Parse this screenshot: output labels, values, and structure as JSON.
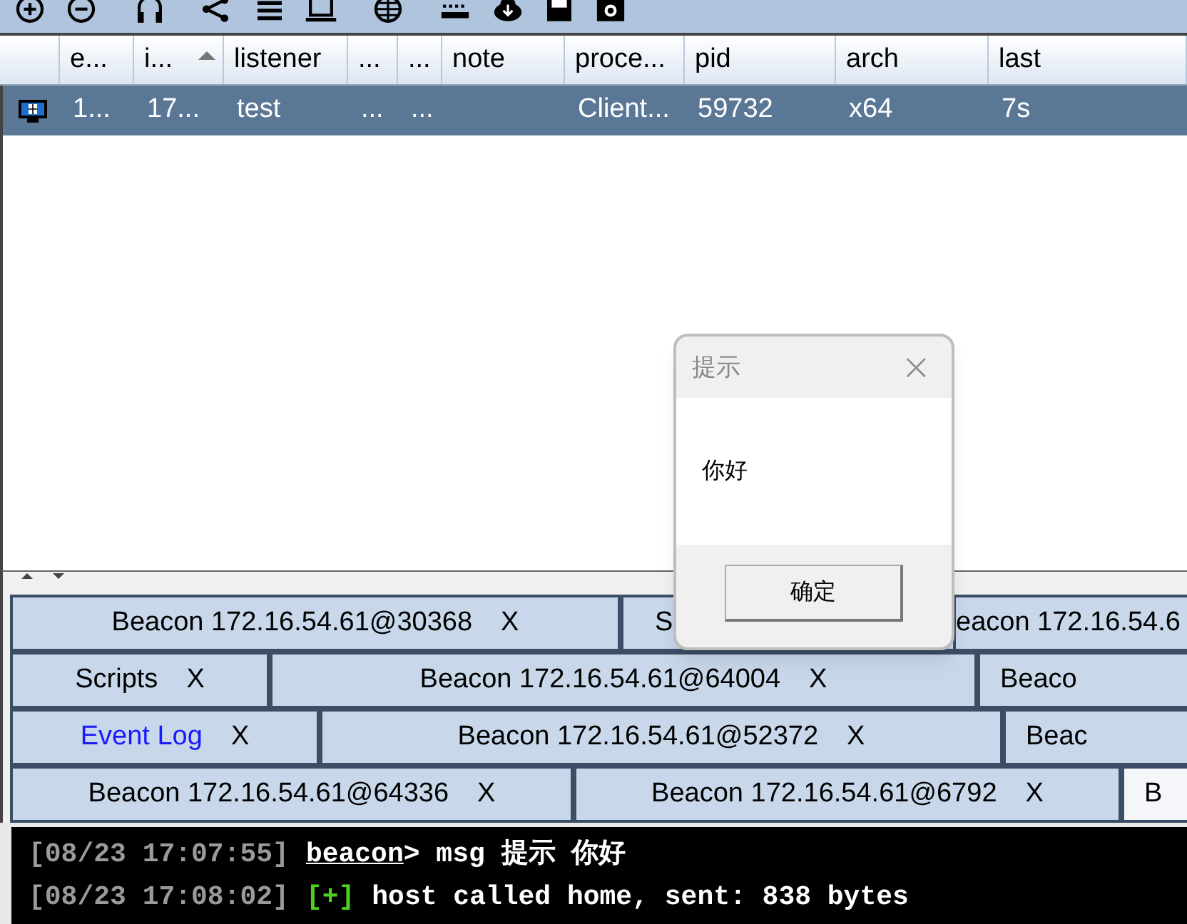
{
  "table": {
    "columns": [
      {
        "label": "e..."
      },
      {
        "label": "i...",
        "sorted": true
      },
      {
        "label": "listener"
      },
      {
        "label": "..."
      },
      {
        "label": "..."
      },
      {
        "label": "note"
      },
      {
        "label": "proce..."
      },
      {
        "label": "pid"
      },
      {
        "label": "arch"
      },
      {
        "label": "last"
      }
    ],
    "rows": [
      {
        "selected": true,
        "cells": [
          "1...",
          "17...",
          "test",
          "...",
          "...",
          "",
          "Client...",
          "59732",
          "x64",
          "7s"
        ]
      }
    ]
  },
  "tab_rows": [
    [
      {
        "label": "Beacon 172.16.54.61@30368",
        "close": "X",
        "selected": false,
        "highlight": false
      },
      {
        "label": "S",
        "selected": false,
        "highlight": false
      },
      {
        "label": "eacon 172.16.54.6",
        "selected": false,
        "highlight": false
      }
    ],
    [
      {
        "label": "Scripts",
        "close": "X",
        "selected": false,
        "highlight": false
      },
      {
        "label": "Beacon 172.16.54.61@64004",
        "close": "X",
        "selected": false,
        "highlight": false
      },
      {
        "label": "Beaco",
        "selected": false,
        "highlight": false
      }
    ],
    [
      {
        "label": "Event Log",
        "close": "X",
        "selected": false,
        "highlight": true
      },
      {
        "label": "Beacon 172.16.54.61@52372",
        "close": "X",
        "selected": false,
        "highlight": false
      },
      {
        "label": "Beac",
        "selected": false,
        "highlight": false
      }
    ],
    [
      {
        "label": "Beacon 172.16.54.61@64336",
        "close": "X",
        "selected": false,
        "highlight": false
      },
      {
        "label": "Beacon 172.16.54.61@6792",
        "close": "X",
        "selected": false,
        "highlight": false
      },
      {
        "label": "B",
        "selected": true,
        "highlight": false
      }
    ]
  ],
  "console": [
    {
      "timestamp": "[08/23 17:07:55]",
      "prompt": "beacon",
      "text": "> msg 提示 你好"
    },
    {
      "timestamp": "[08/23 17:08:02]",
      "marker": "[+]",
      "text": "host called home, sent: 838 bytes"
    }
  ],
  "dialog": {
    "title": "提示",
    "close": "×",
    "message": "你好",
    "button": "确定"
  }
}
